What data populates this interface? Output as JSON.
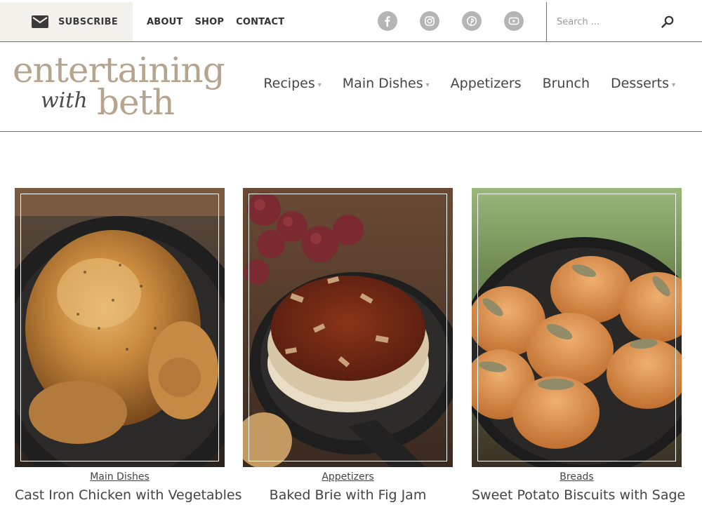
{
  "topbar": {
    "subscribe_label": "SUBSCRIBE",
    "links": [
      "ABOUT",
      "SHOP",
      "CONTACT"
    ],
    "social_icons": [
      "facebook-icon",
      "instagram-icon",
      "pinterest-icon",
      "youtube-icon"
    ],
    "search_placeholder": "Search ..."
  },
  "logo": {
    "line1": "entertaining",
    "script": "with",
    "line2": "beth"
  },
  "nav": {
    "items": [
      {
        "label": "Recipes",
        "dropdown": true
      },
      {
        "label": "Main Dishes",
        "dropdown": true
      },
      {
        "label": "Appetizers",
        "dropdown": false
      },
      {
        "label": "Brunch",
        "dropdown": false
      },
      {
        "label": "Desserts",
        "dropdown": true
      }
    ],
    "caret": "▾"
  },
  "cards": [
    {
      "category": "Main Dishes",
      "title": "Cast Iron Chicken with Vegetables"
    },
    {
      "category": "Appetizers",
      "title": "Baked Brie with Fig Jam"
    },
    {
      "category": "Breads",
      "title": "Sweet Potato Biscuits with Sage"
    }
  ],
  "colors": {
    "accent": "#b6a48e",
    "subscribe_bg": "#f3f1ec",
    "social_icon": "#b5b5b5",
    "text": "#444444"
  }
}
